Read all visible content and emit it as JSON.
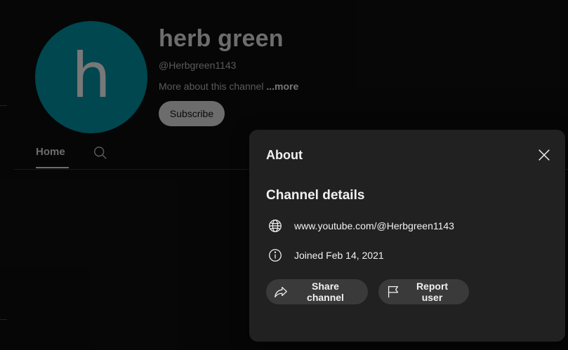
{
  "channel": {
    "avatar_letter": "h",
    "avatar_color": "#006e7a",
    "name": "herb green",
    "handle": "@Herbgreen1143",
    "description": "More about this channel ",
    "more_label": "...more",
    "subscribe_label": "Subscribe"
  },
  "tabs": {
    "home_label": "Home",
    "search_icon": "search-icon"
  },
  "about_dialog": {
    "title": "About",
    "close_icon": "close-icon",
    "details_heading": "Channel details",
    "url": "www.youtube.com/@Herbgreen1143",
    "url_icon": "globe-icon",
    "joined": "Joined Feb 14, 2021",
    "joined_icon": "info-icon",
    "share_label": "Share channel",
    "share_icon": "share-icon",
    "report_label": "Report user",
    "report_icon": "flag-icon"
  },
  "colors": {
    "background": "#0a0a0a",
    "panel": "#212121",
    "button": "#3a3a3a",
    "subscribe": "#a6a6a6"
  }
}
